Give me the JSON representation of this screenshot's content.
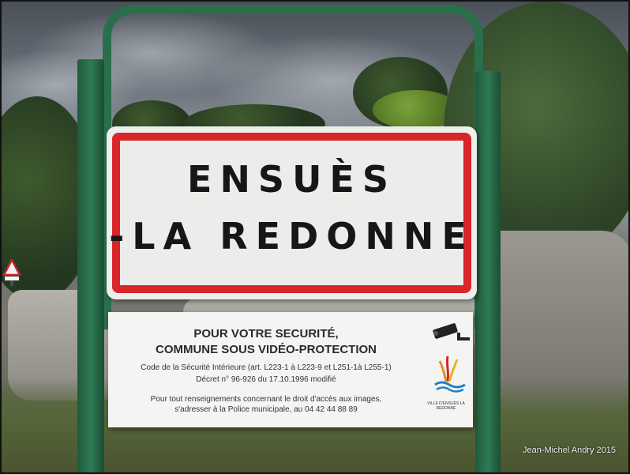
{
  "town_sign": {
    "line1": "ENSUÈS",
    "line2": "-LA REDONNE",
    "border_color": "#d8262a"
  },
  "info_sign": {
    "heading1": "POUR VOTRE SECURITÉ,",
    "heading2": "COMMUNE SOUS VIDÉO-PROTECTION",
    "line1": "Code de la Sécurité Intérieure (art. L223-1 à L223-9 et L251-1à L255-1)",
    "line2": "Décret n° 96-926 du 17.10.1996 modifié",
    "line3": "Pour tout renseignements concernant le droit d'accès aux images,",
    "line4": "s'adresser à la Police municipale, au 04 42 44 88 89",
    "logo_caption": "VILLE D'ENSUÈS LA REDONNE",
    "icons": [
      "cctv-camera-icon",
      "town-logo-icon"
    ]
  },
  "credit": "Jean-Michel Andry 2015"
}
